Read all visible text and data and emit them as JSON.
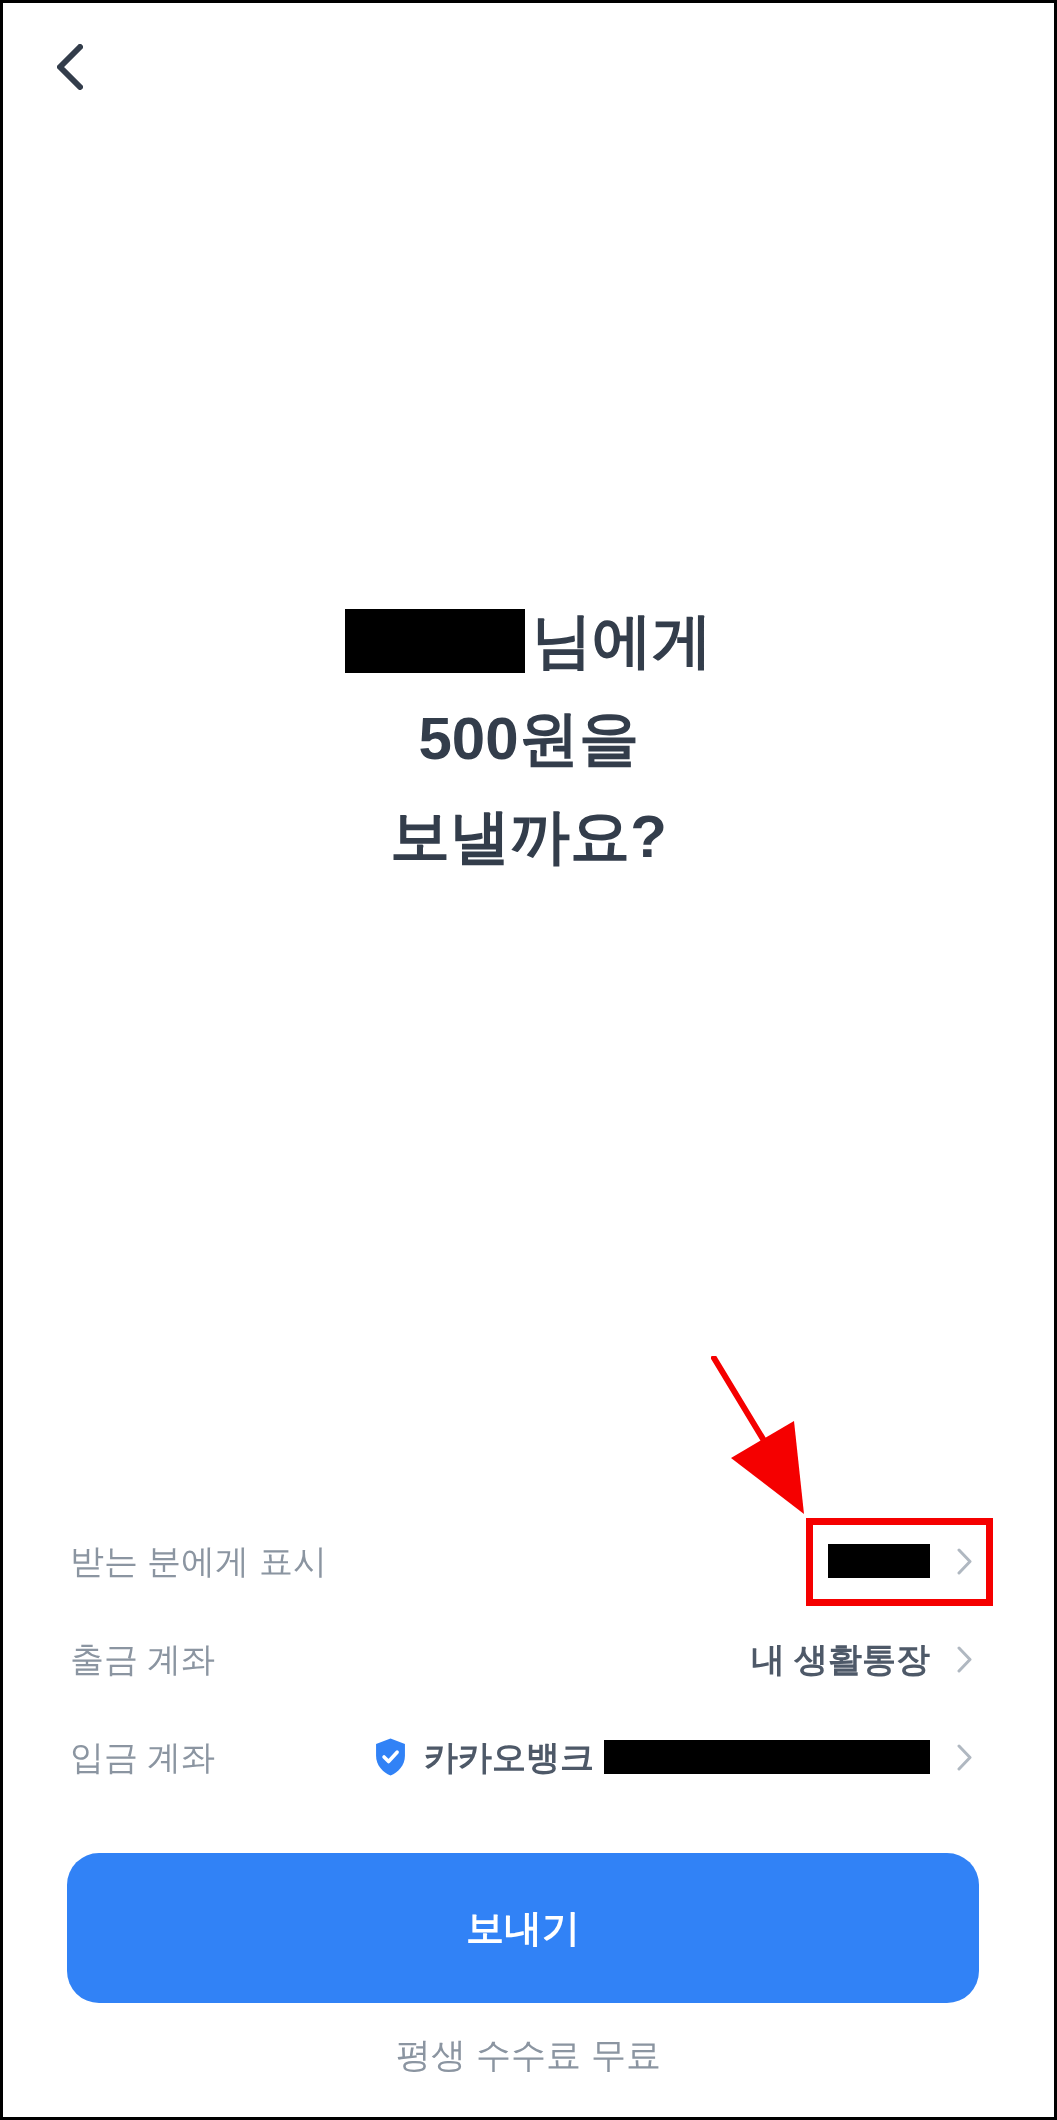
{
  "heading": {
    "lines": [
      {
        "redaction": {
          "kind": "name"
        },
        "text": "님에게"
      },
      {
        "text": "500원을"
      },
      {
        "text": "보낼까요?"
      }
    ]
  },
  "details": [
    {
      "label": "받는 분에게 표시",
      "redaction": {
        "kind": "name"
      },
      "verified": false,
      "annotated": true
    },
    {
      "label": "출금 계좌",
      "value": "내 생활통장",
      "verified": false,
      "annotated": false
    },
    {
      "label": "입금 계좌",
      "value": "카카오뱅크",
      "redaction": {
        "kind": "account"
      },
      "verified": true,
      "annotated": false
    }
  ],
  "primary_button": {
    "label": "보내기"
  },
  "footnote": "평생 수수료 무료"
}
